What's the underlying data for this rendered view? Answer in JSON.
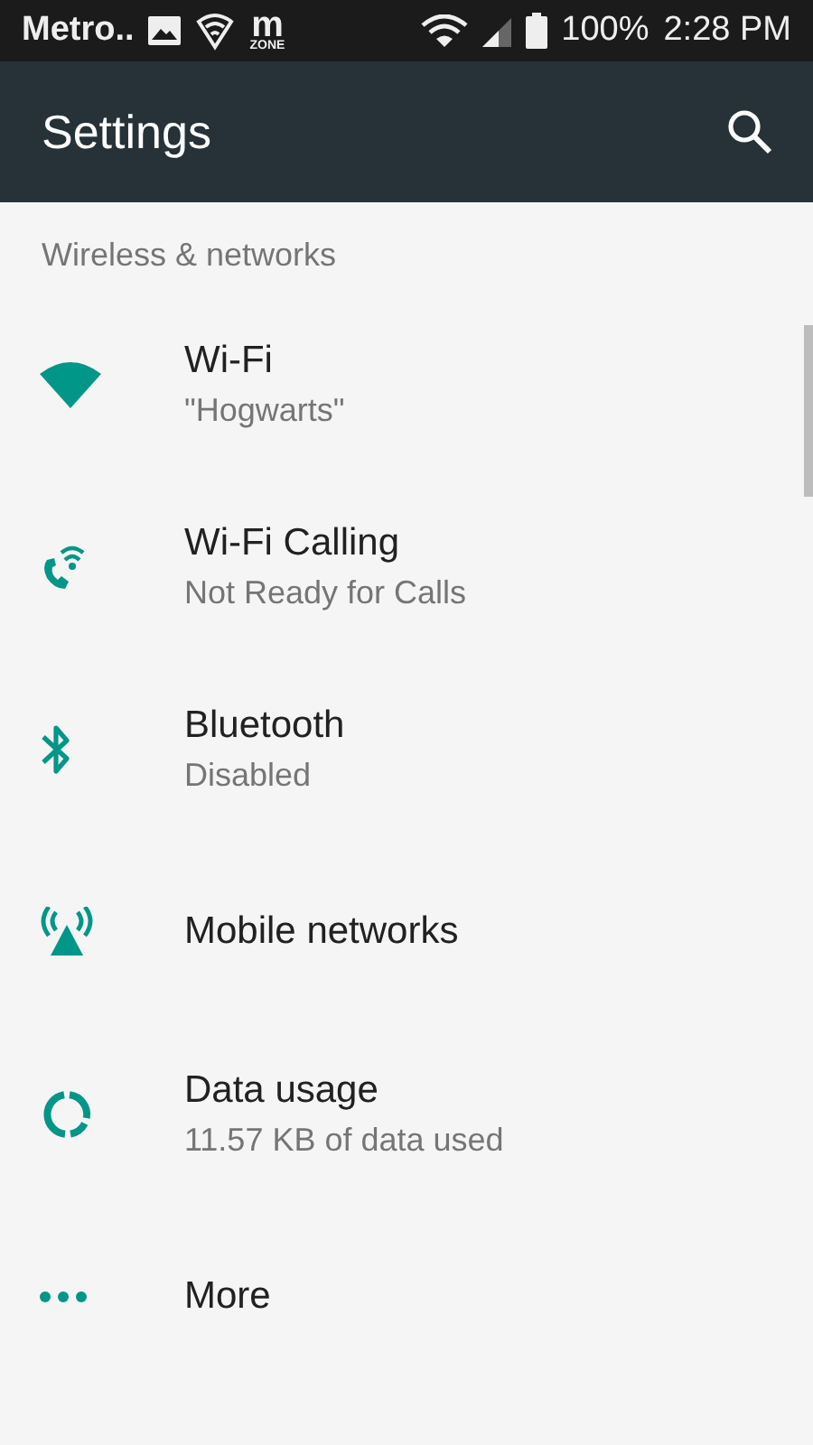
{
  "status_bar": {
    "carrier": "Metro..",
    "app_badge": {
      "letter": "m",
      "sub": "ZONE"
    },
    "battery": "100%",
    "time": "2:28 PM"
  },
  "app_bar": {
    "title": "Settings"
  },
  "section": {
    "header": "Wireless & networks"
  },
  "items": [
    {
      "kind": "wifi",
      "title": "Wi-Fi",
      "subtitle": "\"Hogwarts\""
    },
    {
      "kind": "wifi-calling",
      "title": "Wi-Fi Calling",
      "subtitle": "Not Ready for Calls"
    },
    {
      "kind": "bluetooth",
      "title": "Bluetooth",
      "subtitle": "Disabled"
    },
    {
      "kind": "mobile",
      "title": "Mobile networks"
    },
    {
      "kind": "data",
      "title": "Data usage",
      "subtitle": "11.57 KB of data used"
    },
    {
      "kind": "more",
      "title": "More"
    }
  ]
}
